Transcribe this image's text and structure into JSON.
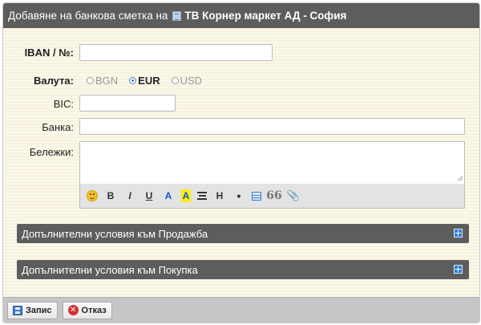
{
  "dialog": {
    "title_prefix": "Добавяне на банкова сметка на",
    "company": "ТВ Корнер маркет АД - София"
  },
  "form": {
    "iban_label": "IBAN / №:",
    "iban_value": "",
    "currency_label": "Валута:",
    "currency_options": [
      "BGN",
      "EUR",
      "USD"
    ],
    "currency_selected": "EUR",
    "bic_label": "BIC:",
    "bic_value": "",
    "bank_label": "Банка:",
    "bank_value": "",
    "notes_label": "Бележки:",
    "notes_value": ""
  },
  "toolbar": {
    "bold": "B",
    "italic": "I",
    "underline": "U",
    "font_color": "A",
    "highlight": "A",
    "heading": "H",
    "bullet": "•",
    "quote": "66",
    "attach": "✎"
  },
  "sections": [
    {
      "label": "Допълнителни условия към Продажба"
    },
    {
      "label": "Допълнителни условия към Покупка"
    }
  ],
  "footer": {
    "save_label": "Запис",
    "cancel_label": "Отказ"
  },
  "colors": {
    "title_bg": "#5d5d5d",
    "panel_bg": "#fbf8ea",
    "accent_blue": "#2f7fce",
    "cancel_red": "#d0322c"
  }
}
